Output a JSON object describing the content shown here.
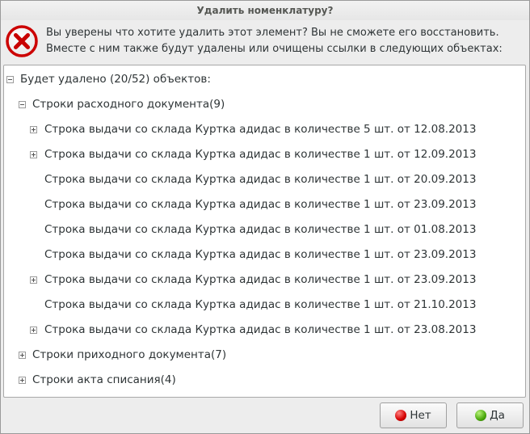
{
  "window": {
    "title": "Удалить номенклатуру?"
  },
  "icons": {
    "error": "error-circle-x-icon",
    "no": "red-dot-icon",
    "yes": "green-dot-icon"
  },
  "colors": {
    "error_red": "#cc0000",
    "no_dot": "#d40000",
    "yes_dot": "#4aa80c"
  },
  "message": {
    "line1": "Вы уверены что хотите удалить этот элемент? Вы не сможете его восстановить.",
    "line2": "Вместе с ним также будут удалены или очищены ссылки в следующих объектах:"
  },
  "tree": {
    "root": {
      "label": "Будет удалено (20/52) объектов:",
      "expanded": true
    },
    "groups": [
      {
        "label": "Строки расходного документа(9)",
        "expanded": true,
        "items": [
          {
            "label": "Строка выдачи со склада Куртка адидас в количестве 5 шт. от 12.08.2013",
            "has_children": true
          },
          {
            "label": "Строка выдачи со склада Куртка адидас в количестве 1 шт. от 12.09.2013",
            "has_children": true
          },
          {
            "label": "Строка выдачи со склада Куртка адидас в количестве 1 шт. от 20.09.2013",
            "has_children": false
          },
          {
            "label": "Строка выдачи со склада Куртка адидас в количестве 1 шт. от 23.09.2013",
            "has_children": false
          },
          {
            "label": "Строка выдачи со склада Куртка адидас в количестве 1 шт. от 01.08.2013",
            "has_children": false
          },
          {
            "label": "Строка выдачи со склада Куртка адидас в количестве 1 шт. от 23.09.2013",
            "has_children": false
          },
          {
            "label": "Строка выдачи со склада Куртка адидас в количестве 1 шт. от 23.09.2013",
            "has_children": true
          },
          {
            "label": "Строка выдачи со склада Куртка адидас в количестве 1 шт. от 21.10.2013",
            "has_children": false
          },
          {
            "label": "Строка выдачи со склада Куртка адидас в количестве 1 шт. от 23.08.2013",
            "has_children": true
          }
        ]
      },
      {
        "label": "Строки приходного документа(7)",
        "expanded": false
      },
      {
        "label": "Строки акта списания(4)",
        "expanded": false
      }
    ]
  },
  "buttons": {
    "no": "Нет",
    "yes": "Да"
  }
}
